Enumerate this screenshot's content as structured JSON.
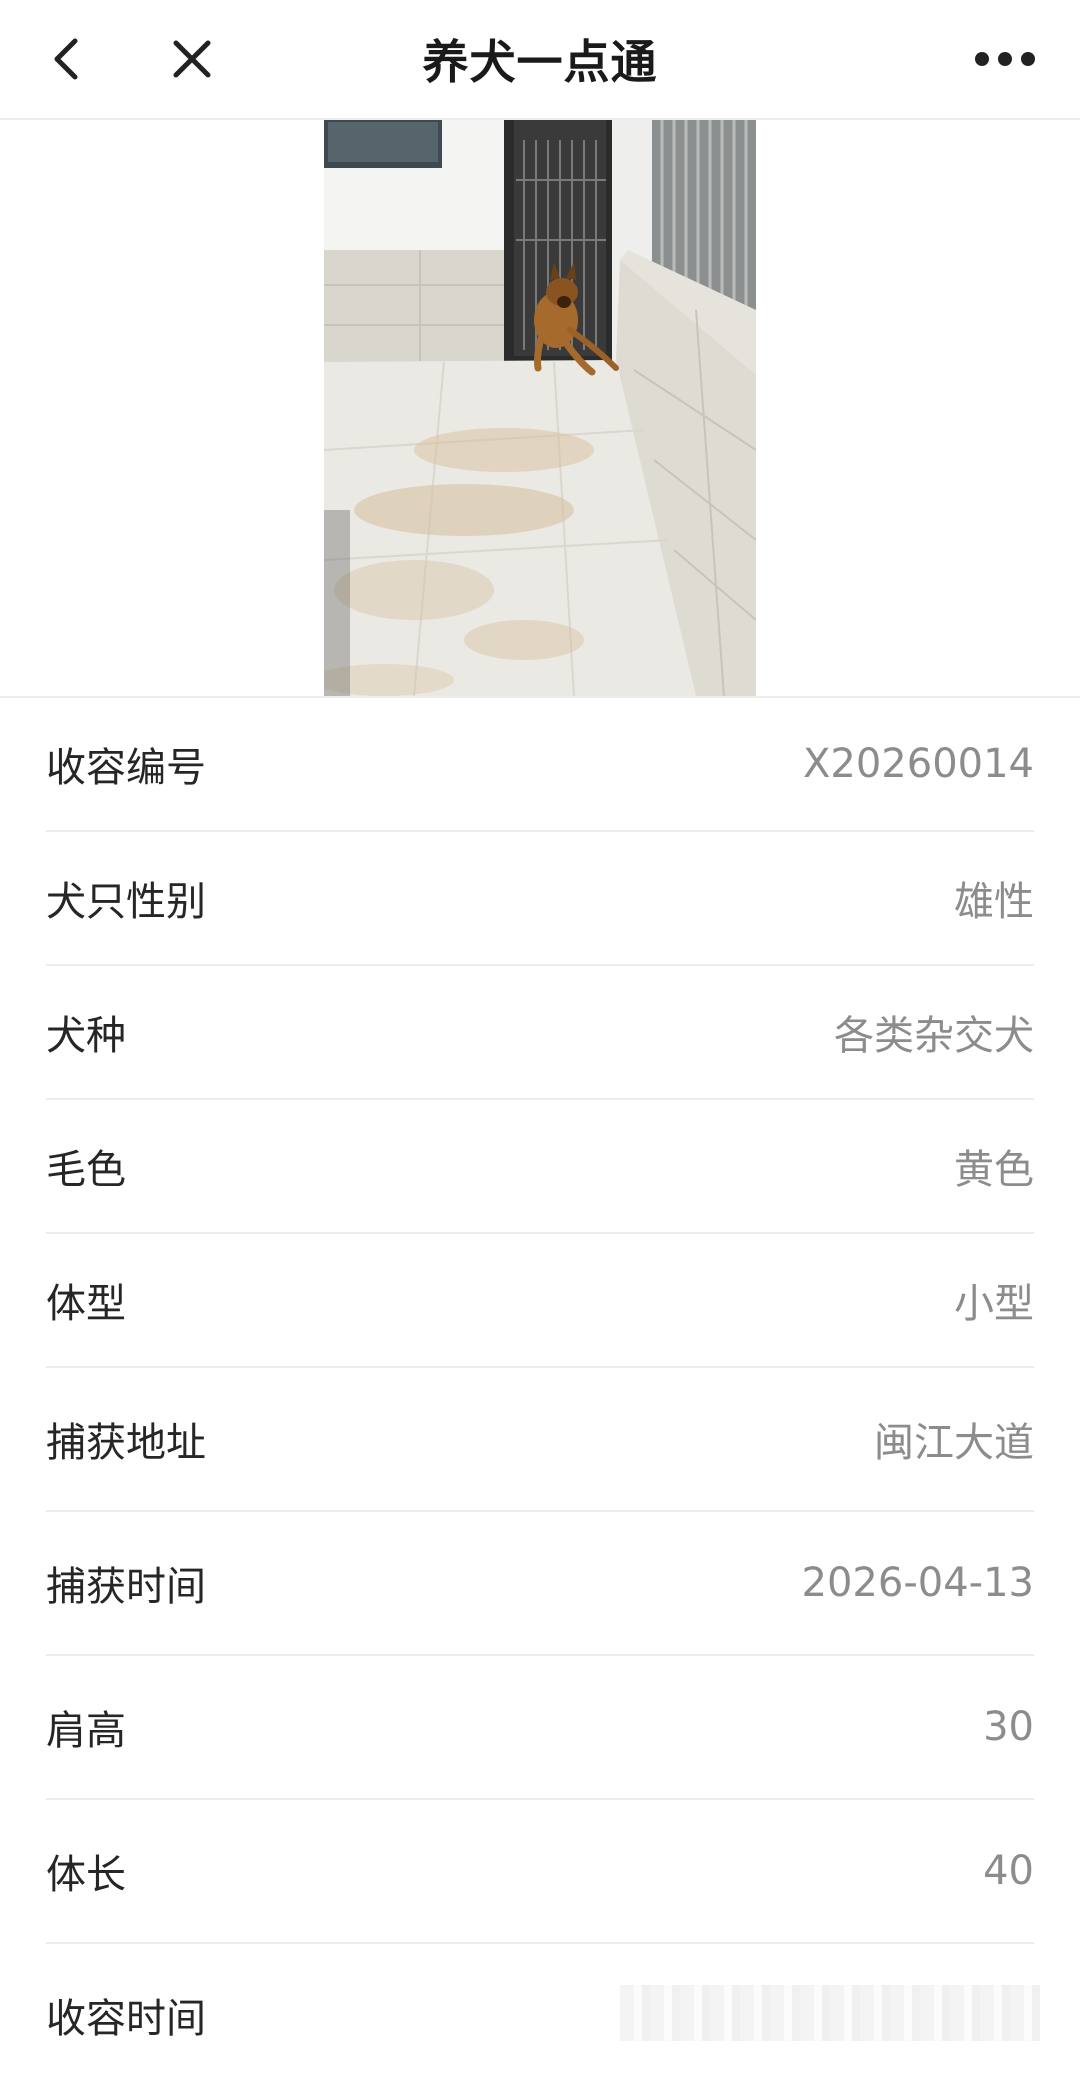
{
  "header": {
    "title": "养犬一点通",
    "back_icon": "chevron-left-icon",
    "close_icon": "close-icon",
    "more_icon": "more-dots-icon"
  },
  "photo": {
    "subject": "dog-photo"
  },
  "details": [
    {
      "label": "收容编号",
      "value": "X20260014"
    },
    {
      "label": "犬只性别",
      "value": "雄性"
    },
    {
      "label": "犬种",
      "value": "各类杂交犬"
    },
    {
      "label": "毛色",
      "value": "黄色"
    },
    {
      "label": "体型",
      "value": "小型"
    },
    {
      "label": "捕获地址",
      "value": "闽江大道"
    },
    {
      "label": "捕获时间",
      "value": "2026-04-13"
    },
    {
      "label": "肩高",
      "value": "30"
    },
    {
      "label": "体长",
      "value": "40"
    },
    {
      "label": "收容时间",
      "value": ""
    }
  ],
  "colors": {
    "label": "#262626",
    "value": "#8c8c8c",
    "divider": "#ececec"
  }
}
